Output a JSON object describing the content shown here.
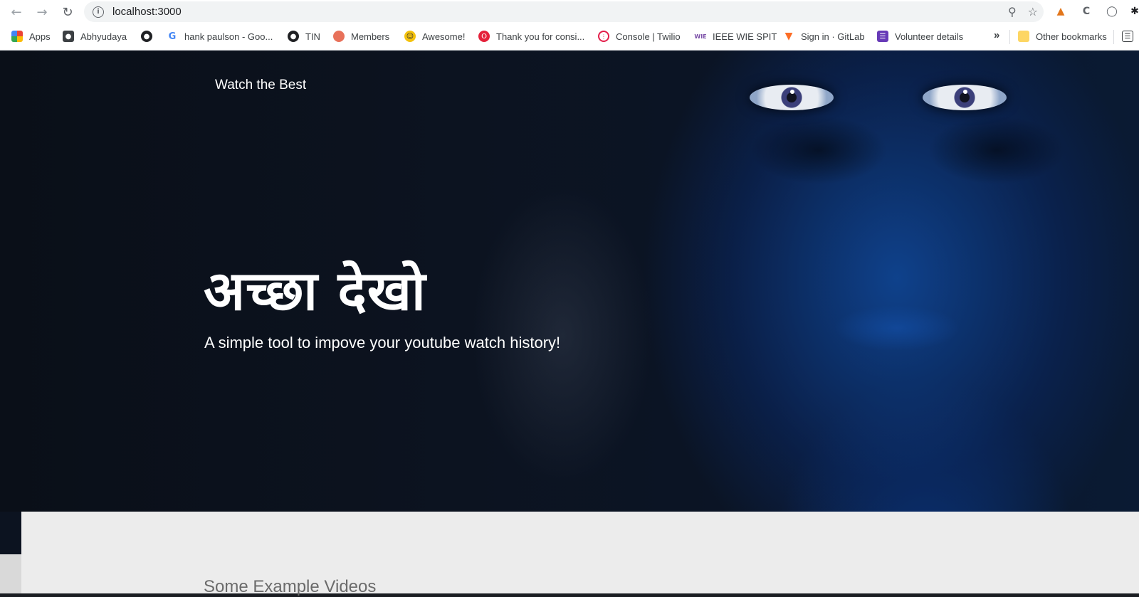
{
  "browser": {
    "url": "localhost:3000",
    "bookmarks": [
      {
        "label": "Apps",
        "icon": "apps-grid-icon"
      },
      {
        "label": "Abhyudaya",
        "icon": "profile-icon"
      },
      {
        "label": "",
        "icon": "globe-icon"
      },
      {
        "label": "hank paulson - Goo...",
        "icon": "google-icon"
      },
      {
        "label": "TIN",
        "icon": "globe-icon"
      },
      {
        "label": "Members",
        "icon": "members-icon"
      },
      {
        "label": "Awesome!",
        "icon": "awesome-icon"
      },
      {
        "label": "Thank you for consi...",
        "icon": "opera-icon"
      },
      {
        "label": "Console | Twilio",
        "icon": "twilio-icon"
      },
      {
        "label": "IEEE WIE SPIT",
        "icon": "wie-icon"
      },
      {
        "label": "Sign in · GitLab",
        "icon": "gitlab-icon"
      },
      {
        "label": "Volunteer details",
        "icon": "forms-icon"
      }
    ],
    "overflow": "»",
    "other_bookmarks": "Other bookmarks"
  },
  "page": {
    "brand": "Watch the Best",
    "hero_title": "अच्छा देखो",
    "hero_subtitle": "A simple tool to impove your youtube watch history!",
    "section_title": "Some Example Videos"
  }
}
